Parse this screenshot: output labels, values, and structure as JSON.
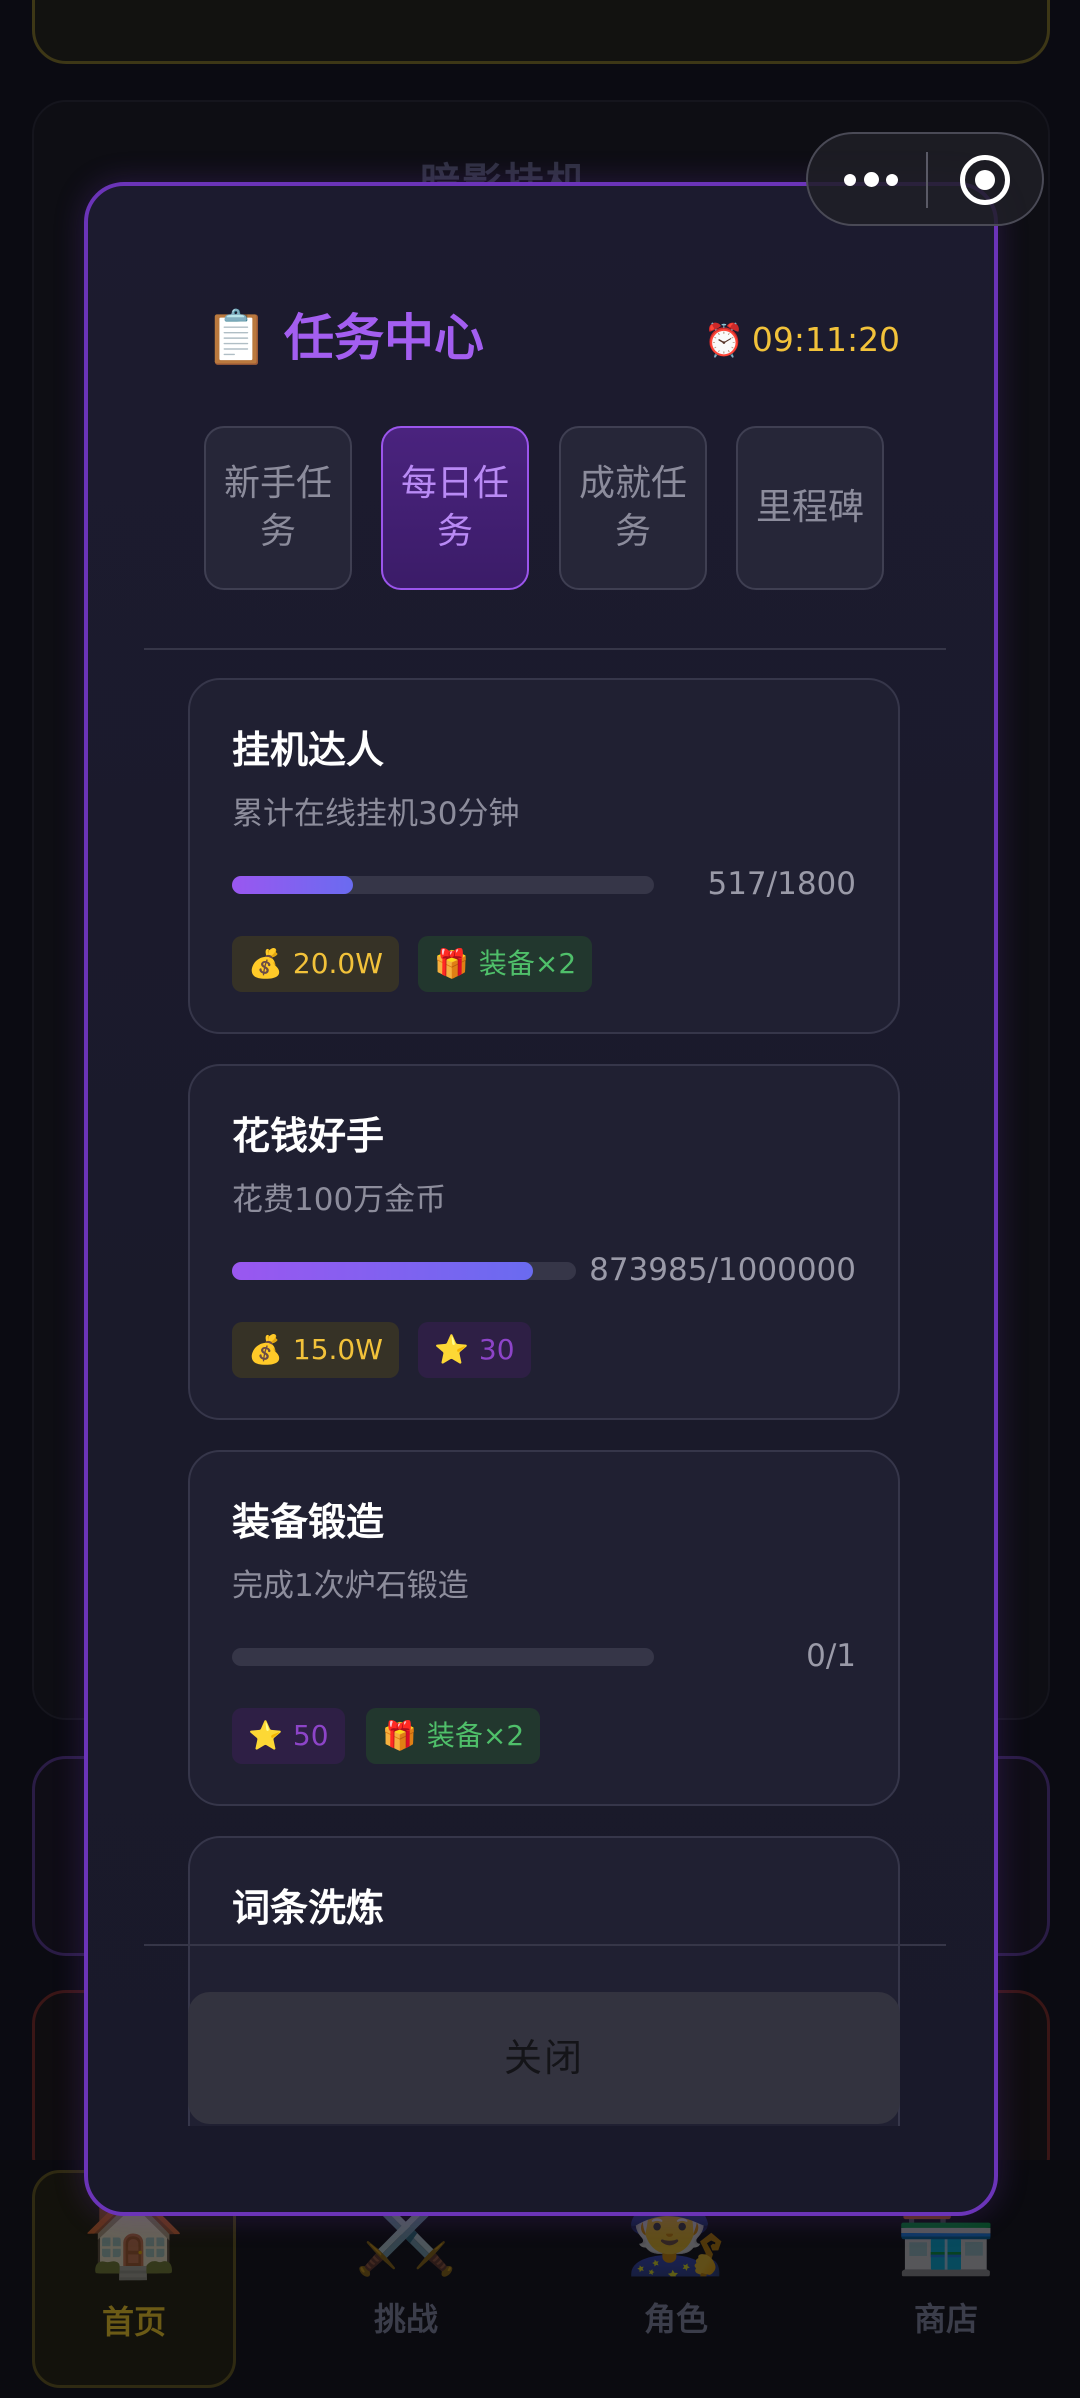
{
  "background": {
    "card_title": "暗影挂机",
    "nav": [
      {
        "icon": "🏠",
        "label": "首页"
      },
      {
        "icon": "⚔️",
        "label": "挑战"
      },
      {
        "icon": "🧙",
        "label": "角色"
      },
      {
        "icon": "🏪",
        "label": "商店"
      }
    ]
  },
  "modal": {
    "title_icon": "📋",
    "title": "任务中心",
    "timer_icon": "⏰",
    "timer": "09:11:20",
    "tabs": [
      {
        "label": "新手任务",
        "active": false
      },
      {
        "label": "每日任务",
        "active": true
      },
      {
        "label": "成就任务",
        "active": false
      },
      {
        "label": "里程碑",
        "active": false
      }
    ],
    "tasks": [
      {
        "title": "挂机达人",
        "desc": "累计在线挂机30分钟",
        "progress_text": "517/1800",
        "progress": 0.287,
        "rewards": [
          {
            "type": "gold",
            "icon": "💰",
            "text": "20.0W"
          },
          {
            "type": "equip",
            "icon": "🎁",
            "text": "装备×2"
          }
        ]
      },
      {
        "title": "花钱好手",
        "desc": "花费100万金币",
        "progress_text": "873985/1000000",
        "progress": 0.874,
        "rewards": [
          {
            "type": "gold",
            "icon": "💰",
            "text": "15.0W"
          },
          {
            "type": "star",
            "icon": "⭐",
            "text": "30"
          }
        ]
      },
      {
        "title": "装备锻造",
        "desc": "完成1次炉石锻造",
        "progress_text": "0/1",
        "progress": 0,
        "rewards": [
          {
            "type": "star",
            "icon": "⭐",
            "text": "50"
          },
          {
            "type": "equip",
            "icon": "🎁",
            "text": "装备×2"
          }
        ]
      },
      {
        "title": "词条洗炼"
      }
    ],
    "close_label": "关闭"
  },
  "colors": {
    "accent_purple": "#a35ef0",
    "timer_gold": "#f2c23a",
    "reward_green": "#4fbf6a",
    "modal_border": "#6b34b8"
  }
}
